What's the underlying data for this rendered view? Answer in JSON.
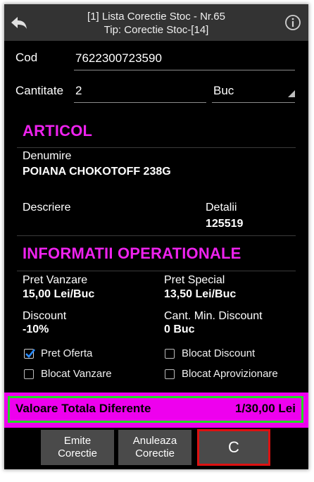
{
  "header": {
    "title_line1": "[1] Lista Corectie Stoc - Nr.65",
    "title_line2": "Tip: Corectie Stoc-[14]"
  },
  "form": {
    "cod_label": "Cod",
    "cod_value": "7622300723590",
    "cantitate_label": "Cantitate",
    "cantitate_value": "2",
    "unit_value": "Buc"
  },
  "articol": {
    "section_title": "ARTICOL",
    "denumire_label": "Denumire",
    "denumire_value": "POIANA CHOKOTOFF 238G",
    "descriere_label": "Descriere",
    "detalii_label": "Detalii",
    "detalii_value": "125519"
  },
  "operational": {
    "section_title": "INFORMATII OPERATIONALE",
    "pret_vanzare_label": "Pret Vanzare",
    "pret_vanzare_value": "15,00 Lei/Buc",
    "pret_special_label": "Pret Special",
    "pret_special_value": "13,50 Lei/Buc",
    "discount_label": "Discount",
    "discount_value": "-10%",
    "cant_min_label": "Cant. Min. Discount",
    "cant_min_value": "0 Buc"
  },
  "checkboxes": {
    "pret_oferta": {
      "label": "Pret Oferta",
      "checked": true
    },
    "blocat_discount": {
      "label": "Blocat Discount",
      "checked": false
    },
    "blocat_vanzare": {
      "label": "Blocat Vanzare",
      "checked": false
    },
    "blocat_aprovizionare": {
      "label": "Blocat Aprovizionare",
      "checked": false
    }
  },
  "total": {
    "label": "Valoare Totala Diferente",
    "value": "1/30,00 Lei"
  },
  "buttons": {
    "emite_line1": "Emite",
    "emite_line2": "Corectie",
    "anuleaza_line1": "Anuleaza",
    "anuleaza_line2": "Corectie",
    "c_label": "C"
  },
  "colors": {
    "accent": "#ee22ee",
    "header_bg": "#333333",
    "highlight_green": "#22dd22",
    "highlight_red": "#dd1111"
  }
}
